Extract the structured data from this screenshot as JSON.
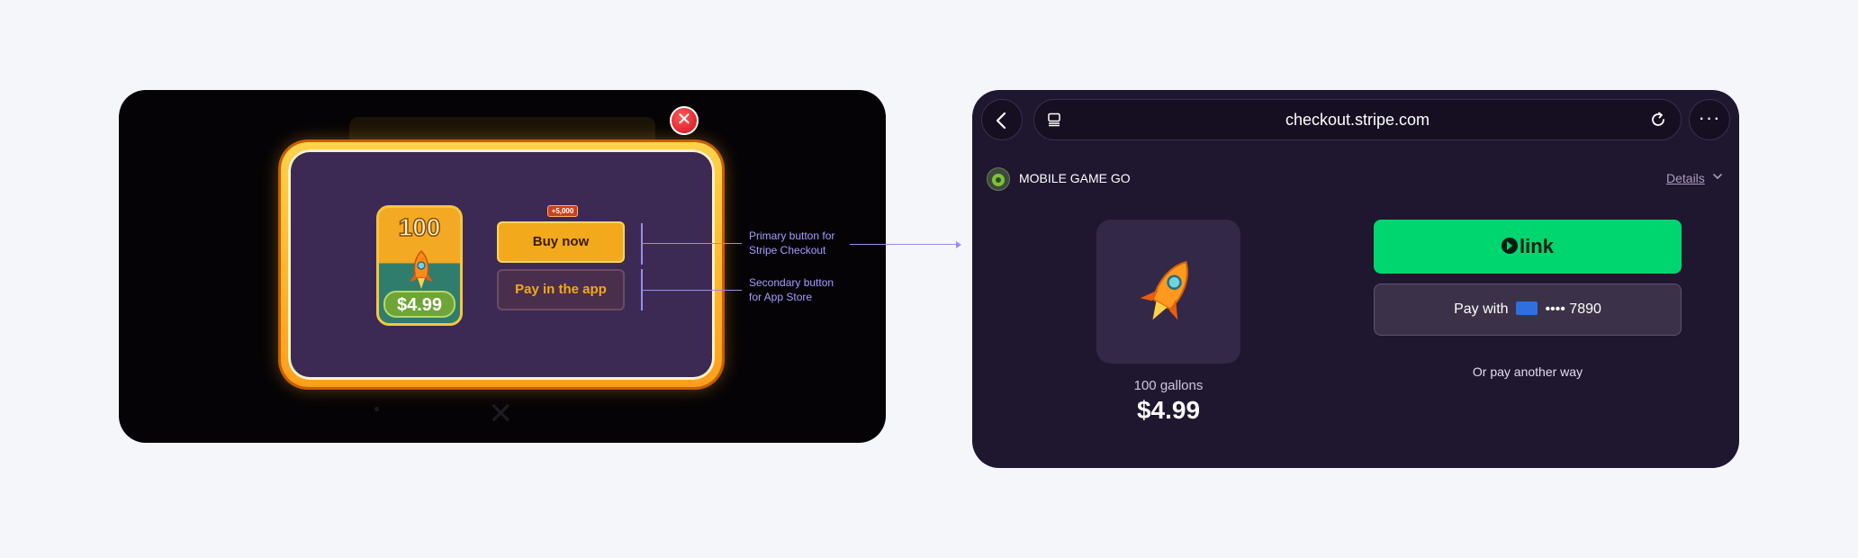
{
  "game": {
    "card_quantity": "100",
    "card_price": "$4.99",
    "badge": "+5,000",
    "primary_button": "Buy now",
    "secondary_button": "Pay in the app",
    "close_icon": "close-icon"
  },
  "annotations": {
    "primary": "Primary button for\nStripe Checkout",
    "secondary": "Secondary button\nfor App Store"
  },
  "browser": {
    "url": "checkout.stripe.com",
    "icons": [
      "back-arrow-icon",
      "tabs-icon",
      "reload-icon",
      "more-icon"
    ]
  },
  "checkout": {
    "merchant_name": "MOBILE GAME GO",
    "details_label": "Details",
    "product_name": "100 gallons",
    "product_price": "$4.99",
    "link_label": "link",
    "pay_with_label": "Pay with",
    "card_last4": "•••• 7890",
    "other_way_label": "Or pay another way"
  },
  "colors": {
    "link_green": "#00d66f",
    "checkout_bg": "#1f1630",
    "game_gold": "#f2a91b",
    "annotation": "#9a8dee"
  }
}
